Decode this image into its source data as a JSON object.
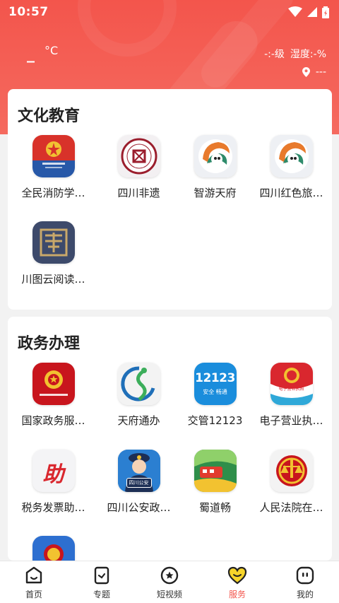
{
  "status_bar": {
    "time": "10:57"
  },
  "weather": {
    "temperature": "_",
    "unit": "°C",
    "aqi": "-:-级",
    "humidity": "湿度:-%",
    "location": "---"
  },
  "sections": [
    {
      "title": "文化教育",
      "apps": [
        {
          "label": "全民消防学…",
          "icon": "fire-safety-emblem-icon"
        },
        {
          "label": "四川非遗",
          "icon": "intangible-heritage-seal-icon"
        },
        {
          "label": "智游天府",
          "icon": "panda-swirl-icon"
        },
        {
          "label": "四川红色旅…",
          "icon": "panda-swirl-icon"
        },
        {
          "label": "川图云阅读…",
          "icon": "library-book-seal-icon"
        }
      ]
    },
    {
      "title": "政务办理",
      "apps": [
        {
          "label": "国家政务服…",
          "icon": "national-emblem-icon"
        },
        {
          "label": "天府通办",
          "icon": "tianfu-swirl-icon"
        },
        {
          "label": "交管12123",
          "icon": "traffic-12123-icon",
          "icon_text": "12123",
          "icon_subtext": "安全 畅通"
        },
        {
          "label": "电子营业执…",
          "icon": "business-license-emblem-icon",
          "icon_text": "电子营业执照"
        },
        {
          "label": "税务发票助…",
          "icon": "tax-assist-icon",
          "icon_text": "助"
        },
        {
          "label": "四川公安政…",
          "icon": "police-officer-icon",
          "icon_text": "四川公安"
        },
        {
          "label": "蜀道畅",
          "icon": "train-road-icon"
        },
        {
          "label": "人民法院在…",
          "icon": "court-emblem-icon"
        }
      ]
    }
  ],
  "tabbar": [
    {
      "label": "首页",
      "icon": "home-smile-icon",
      "active": false
    },
    {
      "label": "专题",
      "icon": "bookmark-topic-icon",
      "active": false
    },
    {
      "label": "短视频",
      "icon": "video-star-icon",
      "active": false
    },
    {
      "label": "服务",
      "icon": "heart-service-icon",
      "active": true
    },
    {
      "label": "我的",
      "icon": "profile-face-icon",
      "active": false
    }
  ],
  "colors": {
    "brand_red": "#f3554c",
    "active_tab": "#f3554c"
  }
}
